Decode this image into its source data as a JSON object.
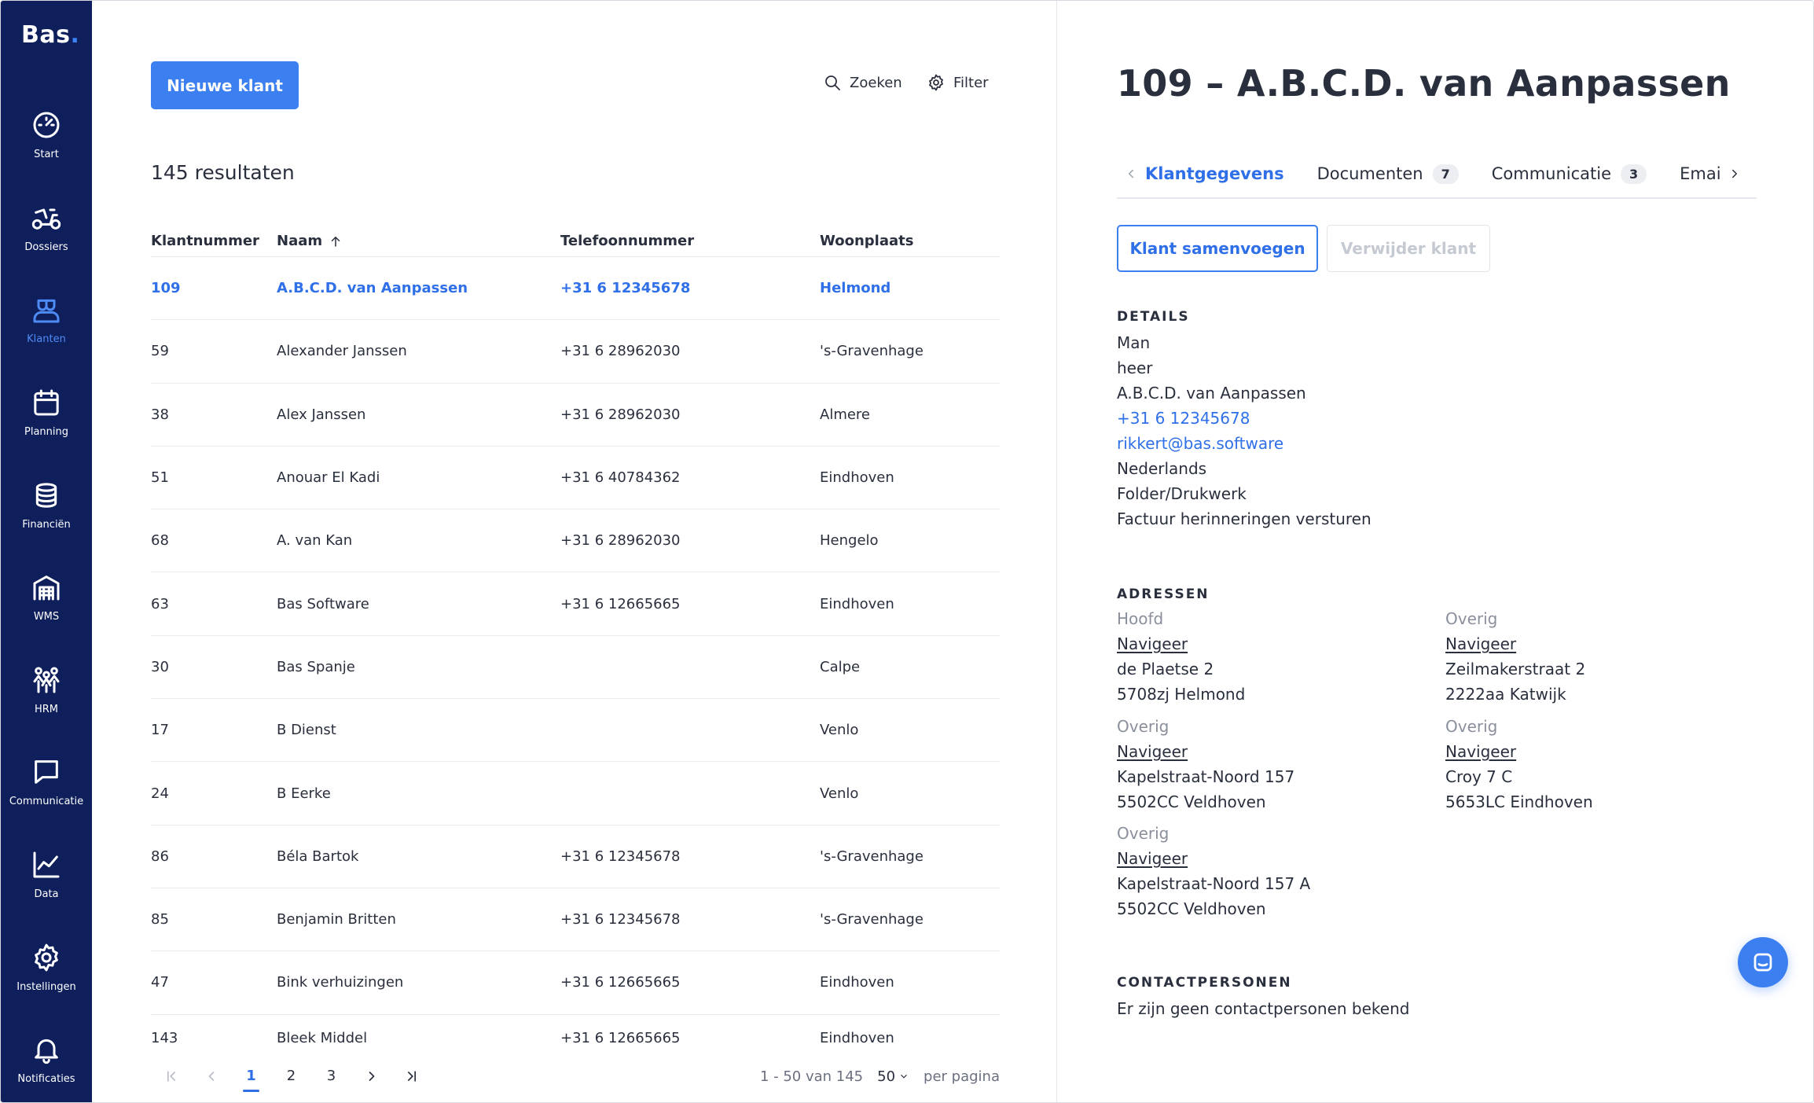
{
  "app": {
    "logo_text": "Bas",
    "logo_dot": ".",
    "accent_color": "#3b7ff0",
    "sidebar_color": "#0e1f5c"
  },
  "sidebar": {
    "items": [
      {
        "label": "Start",
        "icon": "speedometer-icon"
      },
      {
        "label": "Dossiers",
        "icon": "scooter-icon"
      },
      {
        "label": "Klanten",
        "icon": "customers-icon",
        "active": true
      },
      {
        "label": "Planning",
        "icon": "calendar-icon"
      },
      {
        "label": "Financiën",
        "icon": "coins-icon"
      },
      {
        "label": "WMS",
        "icon": "warehouse-icon"
      },
      {
        "label": "HRM",
        "icon": "people-icon"
      },
      {
        "label": "Communicatie",
        "icon": "chat-icon"
      },
      {
        "label": "Data",
        "icon": "line-chart-icon"
      },
      {
        "label": "Instellingen",
        "icon": "gear-icon"
      },
      {
        "label": "Notificaties",
        "icon": "bell-icon"
      }
    ]
  },
  "list": {
    "new_button": "Nieuwe klant",
    "search_label": "Zoeken",
    "filter_label": "Filter",
    "results_label": "145 resultaten",
    "columns": [
      "Klantnummer",
      "Naam",
      "Telefoonnummer",
      "Woonplaats"
    ],
    "rows": [
      {
        "nr": "109",
        "naam": "A.B.C.D. van Aanpassen",
        "tel": "+31 6 12345678",
        "plaats": "Helmond",
        "selected": true
      },
      {
        "nr": "59",
        "naam": "Alexander Janssen",
        "tel": "+31 6 28962030",
        "plaats": "'s-Gravenhage"
      },
      {
        "nr": "38",
        "naam": "Alex Janssen",
        "tel": "+31 6 28962030",
        "plaats": "Almere"
      },
      {
        "nr": "51",
        "naam": "Anouar El Kadi",
        "tel": "+31 6 40784362",
        "plaats": "Eindhoven"
      },
      {
        "nr": "68",
        "naam": "A. van Kan",
        "tel": "+31 6 28962030",
        "plaats": "Hengelo"
      },
      {
        "nr": "63",
        "naam": "Bas Software",
        "tel": "+31 6 12665665",
        "plaats": "Eindhoven"
      },
      {
        "nr": "30",
        "naam": "Bas Spanje",
        "tel": "",
        "plaats": "Calpe"
      },
      {
        "nr": "17",
        "naam": "B Dienst",
        "tel": "",
        "plaats": "Venlo"
      },
      {
        "nr": "24",
        "naam": "B Eerke",
        "tel": "",
        "plaats": "Venlo"
      },
      {
        "nr": "86",
        "naam": "Béla Bartok",
        "tel": "+31 6 12345678",
        "plaats": "'s-Gravenhage"
      },
      {
        "nr": "85",
        "naam": "Benjamin Britten",
        "tel": "+31 6 12345678",
        "plaats": "'s-Gravenhage"
      },
      {
        "nr": "47",
        "naam": "Bink verhuizingen",
        "tel": "+31 6 12665665",
        "plaats": "Eindhoven"
      },
      {
        "nr": "143",
        "naam": "Bleek Middel",
        "tel": "+31 6 12665665",
        "plaats": "Eindhoven"
      }
    ],
    "pager": {
      "pages": [
        "1",
        "2",
        "3"
      ],
      "current": "1",
      "range_label": "1 - 50 van 145",
      "per_page_value": "50",
      "per_page_label": "per pagina"
    }
  },
  "detail": {
    "title": "109 – A.B.C.D. van Aanpassen",
    "tabs": [
      {
        "label": "Klantgegevens",
        "active": true
      },
      {
        "label": "Documenten",
        "badge": "7"
      },
      {
        "label": "Communicatie",
        "badge": "3"
      },
      {
        "label": "Emai"
      }
    ],
    "merge_button": "Klant samenvoegen",
    "delete_button": "Verwijder klant",
    "details_heading": "DETAILS",
    "details": {
      "gender": "Man",
      "salutation": "heer",
      "name": "A.B.C.D. van Aanpassen",
      "phone": "+31 6 12345678",
      "email": "rikkert@bas.software",
      "language": "Nederlands",
      "category": "Folder/Drukwerk",
      "reminder": "Factuur herinneringen versturen"
    },
    "addresses_heading": "ADRESSEN",
    "addresses": [
      {
        "type": "Hoofd",
        "link": "Navigeer",
        "street": "de Plaetse 2",
        "city": "5708zj Helmond"
      },
      {
        "type": "Overig",
        "link": "Navigeer",
        "street": "Zeilmakerstraat 2",
        "city": "2222aa Katwijk"
      },
      {
        "type": "Overig",
        "link": "Navigeer",
        "street": "Kapelstraat-Noord 157",
        "city": "5502CC Veldhoven"
      },
      {
        "type": "Overig",
        "link": "Navigeer",
        "street": "Croy 7 C",
        "city": "5653LC Eindhoven"
      },
      {
        "type": "Overig",
        "link": "Navigeer",
        "street": "Kapelstraat-Noord 157 A",
        "city": "5502CC Veldhoven"
      }
    ],
    "contacts_heading": "CONTACTPERSONEN",
    "contacts_empty": "Er zijn geen contactpersonen bekend"
  }
}
